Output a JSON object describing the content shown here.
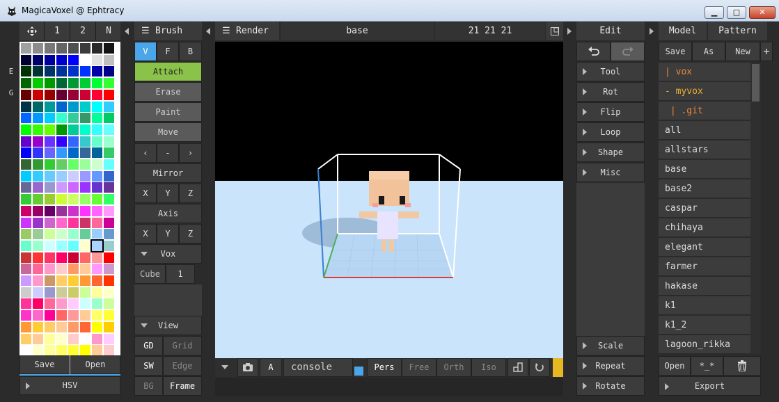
{
  "window": {
    "title": "MagicaVoxel @ Ephtracy",
    "min_label": "▁",
    "max_label": "□",
    "close_label": "✕"
  },
  "palette": {
    "tabs": [
      "1",
      "2",
      "N"
    ],
    "side_labels": [
      "E",
      "G"
    ],
    "save_label": "Save",
    "open_label": "Open",
    "hsv_label": "HSV",
    "colors": [
      "#a0a0a0",
      "#8c8c8c",
      "#787878",
      "#646464",
      "#505050",
      "#3c3c3c",
      "#282828",
      "#141414",
      "#000033",
      "#000066",
      "#000099",
      "#0000cc",
      "#0000ff",
      "#ffffff",
      "#e0e0e0",
      "#c0c0c0",
      "#003300",
      "#003333",
      "#003366",
      "#003399",
      "#0033cc",
      "#0033ff",
      "#0000aa",
      "#000088",
      "#006600",
      "#00cc00",
      "#009900",
      "#006633",
      "#009933",
      "#00cc33",
      "#00ff33",
      "#33ff33",
      "#660000",
      "#cc0000",
      "#990000",
      "#660033",
      "#990033",
      "#cc0033",
      "#ff0033",
      "#ff0000",
      "#003344",
      "#006666",
      "#009999",
      "#0066cc",
      "#0099cc",
      "#00cccc",
      "#00ffff",
      "#33ccff",
      "#0066ff",
      "#0099ff",
      "#00ccff",
      "#33ffcc",
      "#33cc99",
      "#339966",
      "#00ff99",
      "#00cc66",
      "#00ff00",
      "#33ff00",
      "#66ff00",
      "#009900",
      "#00cc99",
      "#00ffcc",
      "#33ffff",
      "#66ffff",
      "#6600cc",
      "#9900cc",
      "#6633ff",
      "#3300ff",
      "#3366ff",
      "#33cccc",
      "#66ffcc",
      "#99ffcc",
      "#0000ff",
      "#3333ff",
      "#6666ff",
      "#3399ff",
      "#0066cc",
      "#336699",
      "#006699",
      "#33cc66",
      "#336633",
      "#339933",
      "#33cc33",
      "#66cc66",
      "#66ff66",
      "#99ff99",
      "#ccffcc",
      "#66ffff",
      "#00ccff",
      "#33ccff",
      "#66ccff",
      "#99ccff",
      "#ccccff",
      "#9999ff",
      "#6699ff",
      "#3366cc",
      "#666699",
      "#9966cc",
      "#9999cc",
      "#cc99ff",
      "#cc66ff",
      "#9933ff",
      "#6633cc",
      "#663399",
      "#33cc33",
      "#66cc33",
      "#99cc33",
      "#ccff33",
      "#ccff66",
      "#99ff66",
      "#66ff33",
      "#33ff66",
      "#cc0066",
      "#990066",
      "#660066",
      "#993399",
      "#cc33cc",
      "#ff33ff",
      "#ff66ff",
      "#ff99ff",
      "#cc33ff",
      "#9933cc",
      "#cc66cc",
      "#ff66cc",
      "#ff3399",
      "#cc3366",
      "#ff6699",
      "#cc0099",
      "#99cc66",
      "#99cc99",
      "#ccff99",
      "#ccffcc",
      "#99ffcc",
      "#66cc99",
      "#99ccff",
      "#6699cc",
      "#66ffcc",
      "#99ffcc",
      "#ccffff",
      "#99ffff",
      "#66ffff",
      "#ffffcc",
      "#aad4ff",
      "#99cccc",
      "#cc3333",
      "#ff3333",
      "#ff3366",
      "#ff0066",
      "#cc0033",
      "#ff6666",
      "#ff9999",
      "#ff0000",
      "#cc6699",
      "#ff6699",
      "#ff99cc",
      "#ffcccc",
      "#ff9966",
      "#ffcc99",
      "#ff99ff",
      "#cc99cc",
      "#cc99ff",
      "#ff99cc",
      "#cc9966",
      "#ffcc66",
      "#ffcc33",
      "#ff9933",
      "#ff6633",
      "#ff3300",
      "#cccccc",
      "#ccccff",
      "#9999cc",
      "#cccc99",
      "#cccc66",
      "#ccff99",
      "#ffff99",
      "#ffffcc",
      "#ff3399",
      "#ff0066",
      "#ff6699",
      "#ff99cc",
      "#ffccff",
      "#ccffff",
      "#99ffcc",
      "#ccff99",
      "#ff33cc",
      "#ff66cc",
      "#ff0099",
      "#ff6666",
      "#ff9999",
      "#ffcc99",
      "#ffff66",
      "#ffff33",
      "#ff9933",
      "#ffcc33",
      "#ffcc66",
      "#ffcc99",
      "#ff9966",
      "#ff6633",
      "#ffff00",
      "#ffcc00",
      "#ffcc66",
      "#ffcc99",
      "#ffff99",
      "#ffffcc",
      "#ffcccc",
      "#ffffff",
      "#ff99cc",
      "#ffccff",
      "#ffffff",
      "#ffffcc",
      "#ffff99",
      "#ffff66",
      "#ffff33",
      "#ffff00",
      "#ffcc99",
      "#ffcccc"
    ],
    "selected_color": "#aad4ff"
  },
  "brush": {
    "header": "Brush",
    "modes": [
      "V",
      "F",
      "B"
    ],
    "actions": [
      "Attach",
      "Erase",
      "Paint",
      "Move"
    ],
    "nudge": [
      "‹",
      "-",
      "›"
    ],
    "mirror_label": "Mirror",
    "axis_label": "Axis",
    "axes": [
      "X",
      "Y",
      "Z"
    ],
    "vox_label": "Vox",
    "cube_label": "Cube",
    "cube_value": "1",
    "view_label": "View",
    "view_rows": [
      [
        "GD",
        "Grid"
      ],
      [
        "SW",
        "Edge"
      ],
      [
        "BG",
        "Frame"
      ]
    ]
  },
  "render": {
    "header": "Render",
    "model_name": "base",
    "dims": "21  21  21",
    "console_label": "console",
    "a_label": "A",
    "projections": [
      "Pers",
      "Free",
      "Orth",
      "Iso"
    ]
  },
  "edit": {
    "header": "Edit",
    "items": [
      "Tool",
      "Rot",
      "Flip",
      "Loop",
      "Shape",
      "Misc"
    ],
    "bottom_items": [
      "Scale",
      "Repeat",
      "Rotate"
    ]
  },
  "model": {
    "tabs": [
      "Model",
      "Pattern"
    ],
    "actions": [
      "Save",
      "As",
      "New",
      "+"
    ],
    "files": [
      {
        "name": "| vox",
        "color": "orange"
      },
      {
        "name": "- myvox",
        "color": "yellow"
      },
      {
        "name": " | .git",
        "color": "orange"
      },
      {
        "name": "all",
        "color": "normal"
      },
      {
        "name": "allstars",
        "color": "normal"
      },
      {
        "name": "base",
        "color": "normal"
      },
      {
        "name": "base2",
        "color": "normal"
      },
      {
        "name": "caspar",
        "color": "normal"
      },
      {
        "name": "chihaya",
        "color": "normal"
      },
      {
        "name": "elegant",
        "color": "normal"
      },
      {
        "name": "farmer",
        "color": "normal"
      },
      {
        "name": "hakase",
        "color": "normal"
      },
      {
        "name": "k1",
        "color": "normal"
      },
      {
        "name": "k1_2",
        "color": "normal"
      },
      {
        "name": "lagoon_rikka",
        "color": "normal"
      }
    ],
    "open_label": "Open",
    "pattern_label": "*_*",
    "export_label": "Export"
  }
}
